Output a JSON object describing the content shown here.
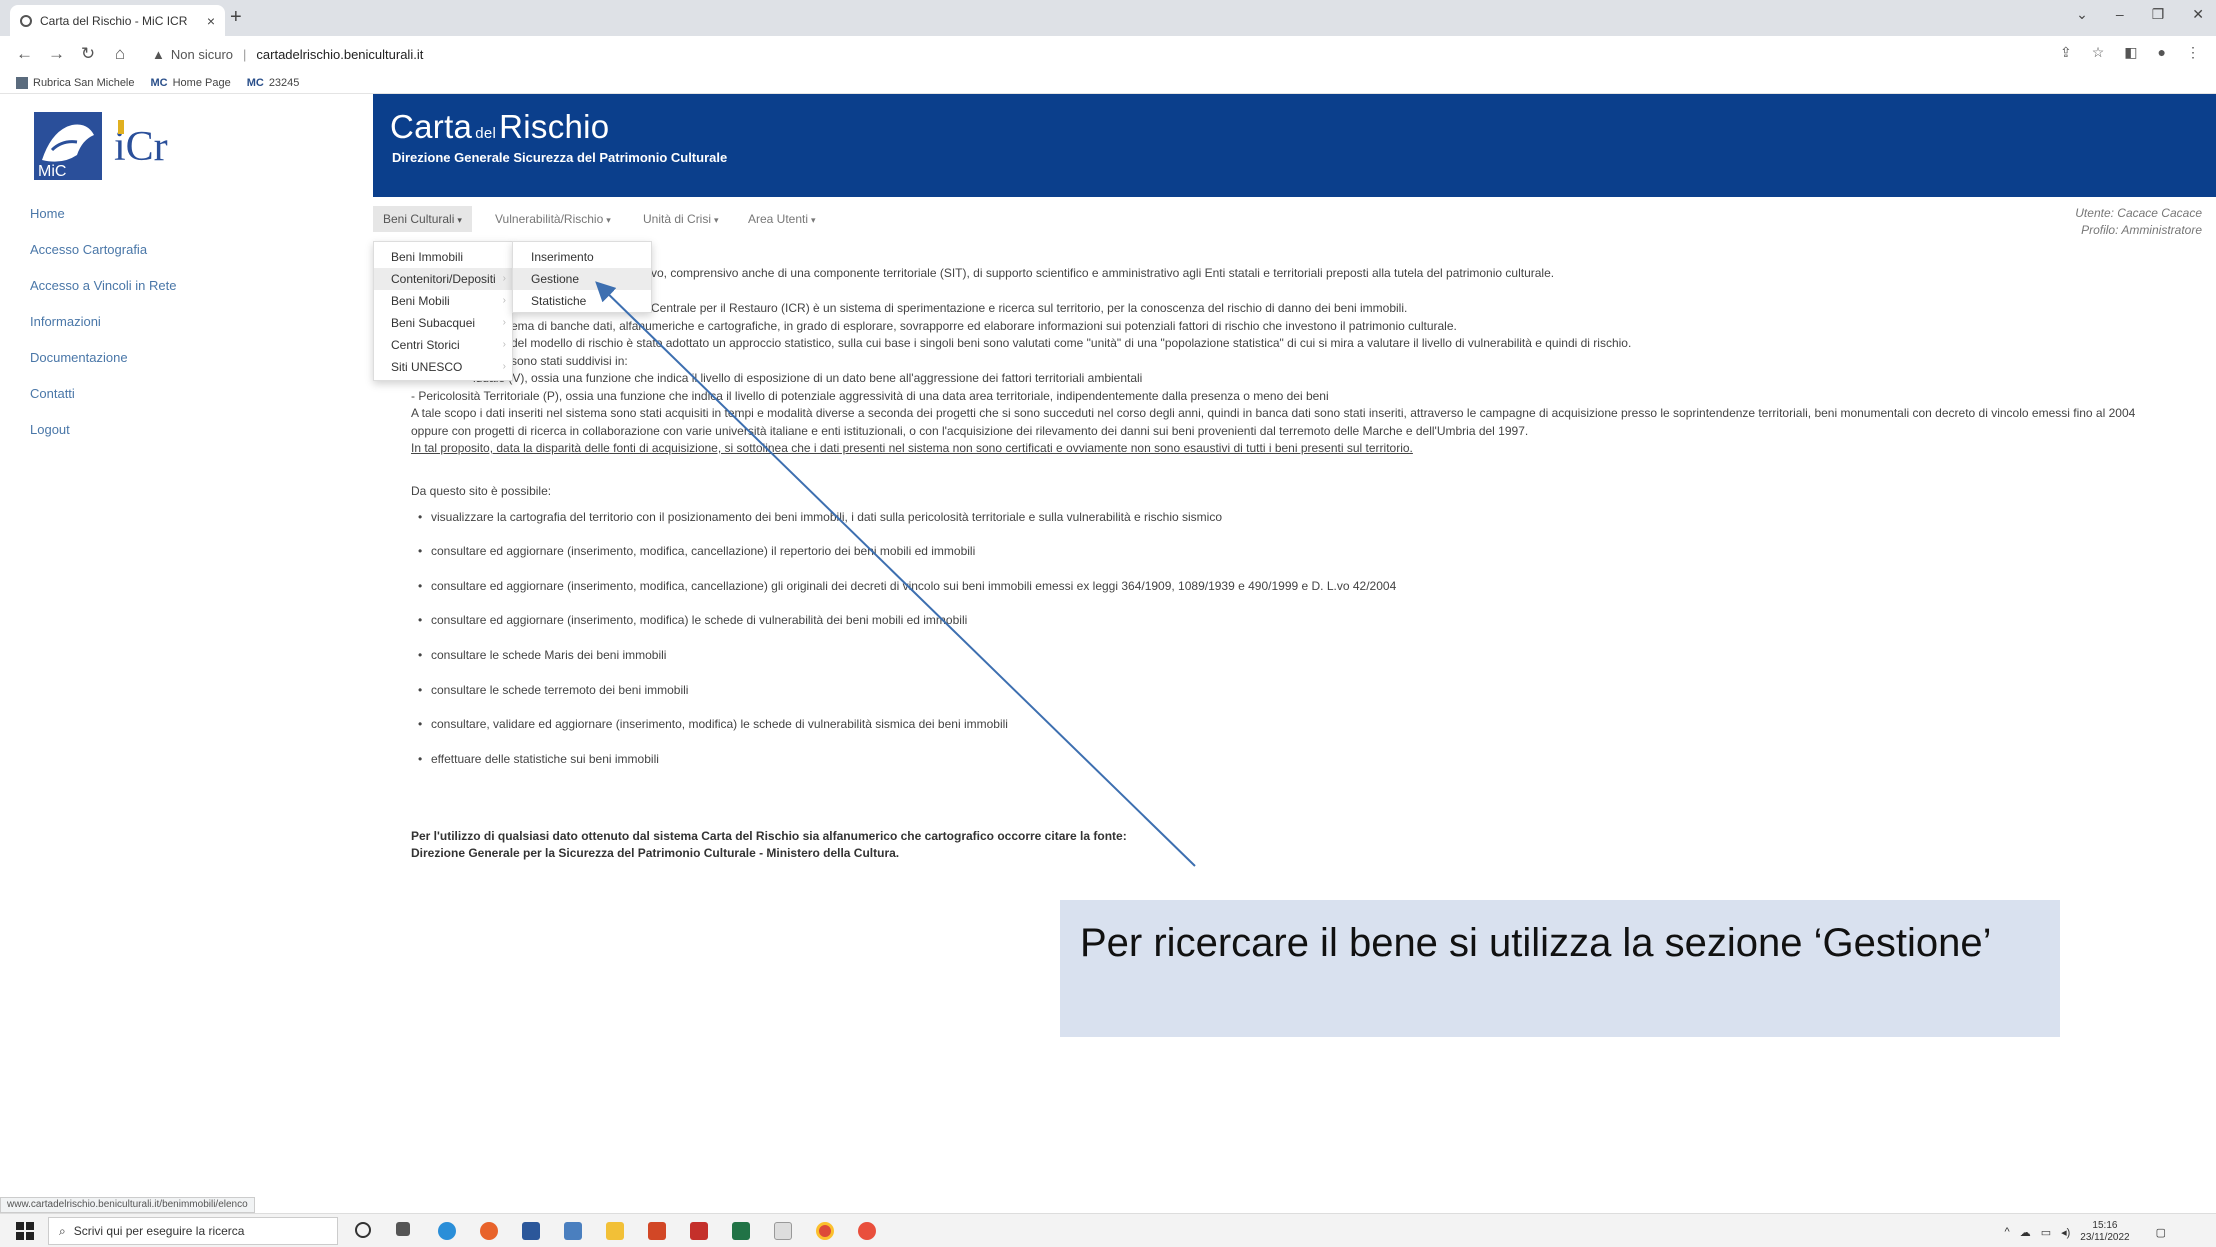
{
  "browser": {
    "tab_title": "Carta del Rischio - MiC ICR",
    "tab_close": "×",
    "new_tab": "+",
    "insecure_label": "Non sicuro",
    "url": "cartadelrischio.beniculturali.it",
    "bookmarks": [
      "Rubrica San Michele",
      "Home Page",
      "23245"
    ],
    "bookmark_prefixes": [
      "MC",
      "MC"
    ],
    "status_url": "www.cartadelrischio.beniculturali.it/benimmobili/elenco"
  },
  "header": {
    "title_main": "Carta",
    "title_small": "del",
    "title_end": "Rischio",
    "subtitle": "Direzione Generale Sicurezza del Patrimonio Culturale"
  },
  "logo": {
    "text_mic": "MiC",
    "text_icr": "iCr"
  },
  "sidebar": {
    "items": [
      {
        "label": "Home"
      },
      {
        "label": "Accesso Cartografia"
      },
      {
        "label": "Accesso a Vincoli in Rete"
      },
      {
        "label": "Informazioni"
      },
      {
        "label": "Documentazione"
      },
      {
        "label": "Contatti"
      },
      {
        "label": "Logout"
      }
    ]
  },
  "menu": {
    "items": [
      {
        "label": "Beni Culturali"
      },
      {
        "label": "Vulnerabilità/Rischio"
      },
      {
        "label": "Unità di Crisi"
      },
      {
        "label": "Area Utenti"
      }
    ],
    "caret": "▾"
  },
  "user": {
    "line1": "Utente: Cacace Cacace",
    "line2": "Profilo: Amministratore"
  },
  "dropdown1": {
    "items": [
      {
        "label": "Beni Immobili"
      },
      {
        "label": "Contenitori/Depositi"
      },
      {
        "label": "Beni Mobili"
      },
      {
        "label": "Beni Subacquei"
      },
      {
        "label": "Centri Storici"
      },
      {
        "label": "Siti UNESCO"
      }
    ],
    "chevron": "›"
  },
  "dropdown2": {
    "items": [
      {
        "label": "Inserimento"
      },
      {
        "label": "Gestione"
      },
      {
        "label": "Statistiche"
      }
    ]
  },
  "content": {
    "intro_lines": [
      "vo, comprensivo anche di una componente territoriale (SIT), di supporto scientifico e amministrativo agli Enti statali e territoriali preposti alla tutela del patrimonio culturale.",
      "Centrale per il Restauro (ICR) è un sistema di sperimentazione e ricerca sul territorio, per la conoscenza del rischio di danno dei beni immobili.",
      "ema di banche dati, alfanumeriche e cartografiche, in grado di esplorare, sovrapporre ed elaborare informazioni sui potenziali fattori di rischio che investono il patrimonio culturale.",
      "del modello di rischio è stato adottato un approccio statistico, sulla cui base i singoli beni sono valutati come \"unità\" di una \"popolazione statistica\" di cui si mira a valutare il livello di vulnerabilità e quindi di rischio.",
      "sono stati suddivisi in:",
      "iduale (V), ossia una funzione che indica il livello di esposizione di un dato bene all'aggressione dei fattori territoriali ambientali",
      "- Pericolosità Territoriale (P), ossia una funzione che indica il livello di potenziale aggressività di una data area territoriale, indipendentemente dalla presenza o meno dei beni",
      "A tale scopo i dati inseriti nel sistema sono stati acquisiti in tempi e modalità diverse a seconda dei progetti che si sono succeduti nel corso degli anni, quindi in banca dati sono stati inseriti, attraverso le campagne di acquisizione presso le soprintendenze territoriali, beni monumentali con decreto di vincolo emessi fino al 2004",
      "oppure con progetti di ricerca in collaborazione con varie università italiane e enti istituzionali, o con l'acquisizione dei rilevamento dei danni sui beni provenienti dal terremoto delle Marche e dell'Umbria del 1997.",
      "In tal proposito, data la disparità delle fonti di acquisizione, si sottolinea che i dati presenti nel sistema non sono certificati e ovviamente non sono esaustivi di tutti i beni presenti sul territorio."
    ],
    "possible_heading": "Da questo sito è possibile:",
    "bullets": [
      "visualizzare la cartografia del territorio con il posizionamento dei beni immobili, i dati sulla pericolosità territoriale e sulla vulnerabilità e rischio sismico",
      "consultare ed aggiornare (inserimento, modifica, cancellazione) il repertorio dei beni mobili ed immobili",
      "consultare ed aggiornare (inserimento, modifica, cancellazione) gli originali dei decreti di vincolo sui beni immobili emessi ex leggi 364/1909, 1089/1939 e 490/1999 e D. L.vo 42/2004",
      "consultare ed aggiornare (inserimento, modifica) le schede di vulnerabilità dei beni mobili ed immobili",
      "consultare le schede Maris dei beni immobili",
      "consultare le schede terremoto dei beni immobili",
      "consultare, validare ed aggiornare (inserimento, modifica) le schede di vulnerabilità sismica dei beni immobili",
      "effettuare delle statistiche sui beni immobili"
    ],
    "source_line1": "Per l'utilizzo di qualsiasi dato ottenuto dal sistema Carta del Rischio sia alfanumerico che cartografico occorre citare la fonte:",
    "source_line2": "Direzione Generale per la Sicurezza del Patrimonio Culturale - Ministero della Cultura."
  },
  "callout": {
    "text": "Per ricercare il bene si utilizza la sezione ‘Gestione’"
  },
  "taskbar": {
    "search_placeholder": "Scrivi qui per eseguire la ricerca",
    "time": "15:16",
    "date": "23/11/2022"
  },
  "colors": {
    "header_blue": "#0b3f8c",
    "link_blue": "#4a77a8",
    "callout_bg": "#d9e1ef",
    "arrow": "#3d6fb0"
  }
}
